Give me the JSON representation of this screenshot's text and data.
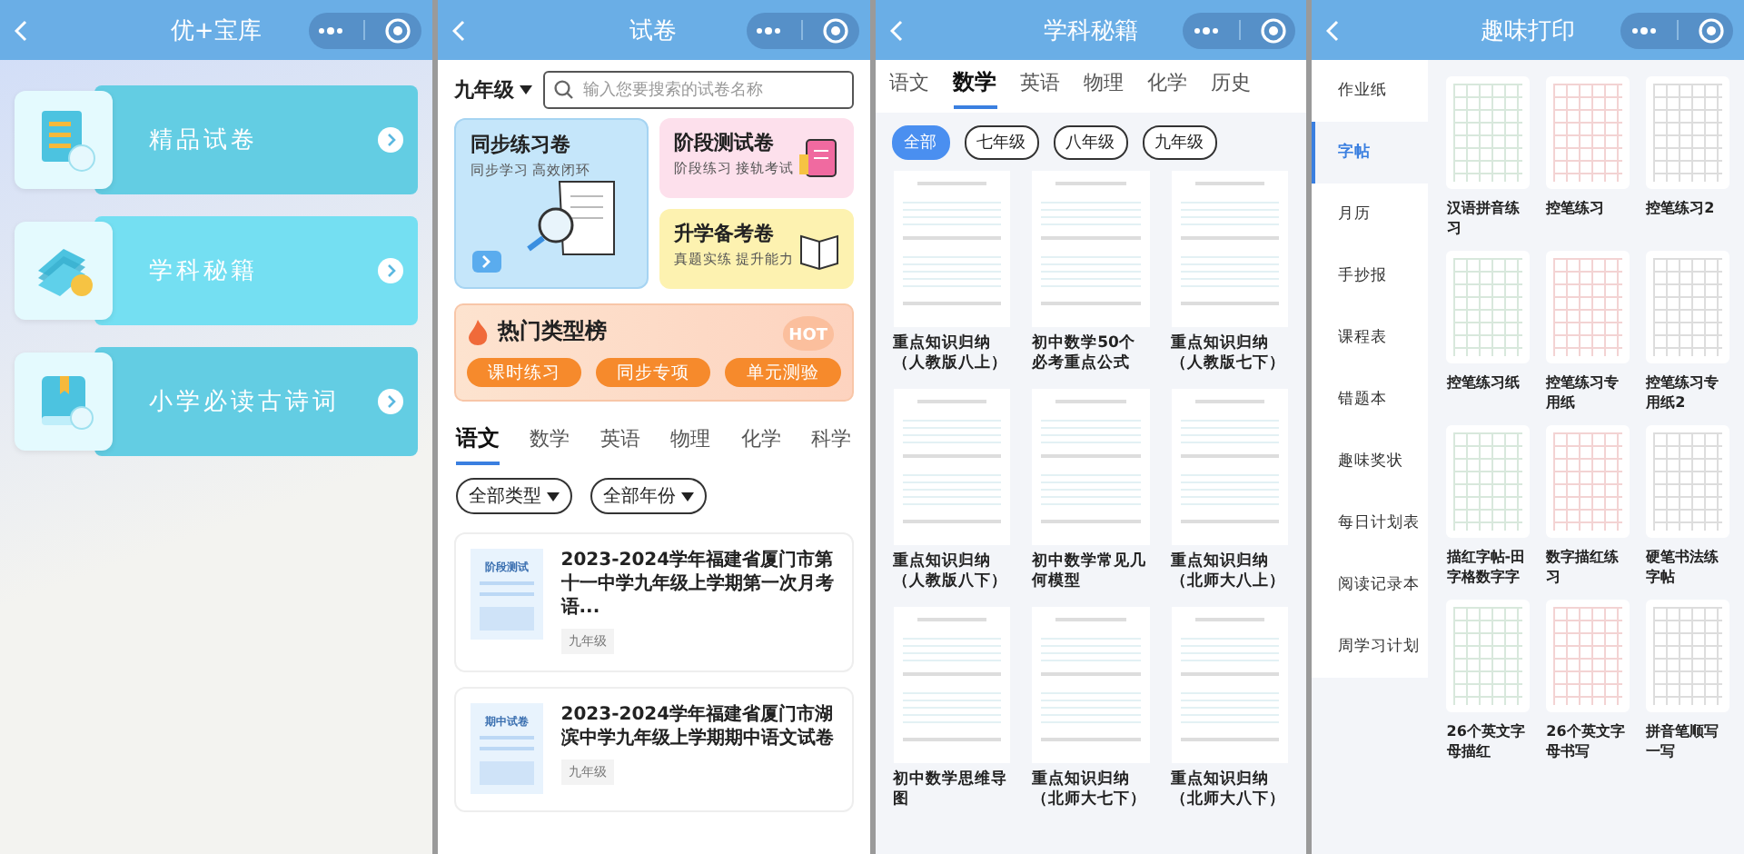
{
  "home": {
    "title": "优+宝库",
    "entries": [
      {
        "kind": "paper",
        "label": "精品试卷"
      },
      {
        "kind": "books",
        "label": "学科秘籍"
      },
      {
        "kind": "book",
        "label": "小学必读古诗词"
      }
    ]
  },
  "exam": {
    "title": "试卷",
    "grade_picker": "九年级",
    "search": {
      "placeholder": "输入您要搜索的试卷名称"
    },
    "cards": [
      {
        "kind": "sync",
        "title": "同步练习卷",
        "subtitle": "同步学习 高效闭环"
      },
      {
        "kind": "stage",
        "title": "阶段测试卷",
        "subtitle": "阶段练习 接轨考试"
      },
      {
        "kind": "entrance",
        "title": "升学备考卷",
        "subtitle": "真题实练 提升能力"
      }
    ],
    "hot": {
      "title": "热门类型榜",
      "mark": "HOT",
      "chips": [
        "课时练习",
        "同步专项",
        "单元测验"
      ]
    },
    "subjects": [
      {
        "label": "语文",
        "selected": true
      },
      {
        "label": "数学",
        "selected": false
      },
      {
        "label": "英语",
        "selected": false
      },
      {
        "label": "物理",
        "selected": false
      },
      {
        "label": "化学",
        "selected": false
      },
      {
        "label": "科学",
        "selected": false
      }
    ],
    "filters": [
      "全部类型",
      "全部年份"
    ],
    "papers": [
      {
        "tag": "阶段测试",
        "title": "2023-2024学年福建省厦门市第十一中学九年级上学期第一次月考语...",
        "grade": "九年级"
      },
      {
        "tag": "期中试卷",
        "title": "2023-2024学年福建省厦门市湖滨中学九年级上学期期中语文试卷",
        "grade": "九年级"
      }
    ]
  },
  "subject": {
    "title": "学科秘籍",
    "tabs": [
      {
        "label": "语文",
        "selected": false
      },
      {
        "label": "数学",
        "selected": true
      },
      {
        "label": "英语",
        "selected": false
      },
      {
        "label": "物理",
        "selected": false
      },
      {
        "label": "化学",
        "selected": false
      },
      {
        "label": "历史",
        "selected": false
      }
    ],
    "grades": [
      {
        "label": "全部",
        "selected": true
      },
      {
        "label": "七年级",
        "selected": false
      },
      {
        "label": "八年级",
        "selected": false
      },
      {
        "label": "九年级",
        "selected": false
      }
    ],
    "items": [
      {
        "title": "重点知识归纳（人教版八上）"
      },
      {
        "title": "初中数学50个必考重点公式"
      },
      {
        "title": "重点知识归纳（人教版七下）"
      },
      {
        "title": "重点知识归纳（人教版八下）"
      },
      {
        "title": "初中数学常见几何模型"
      },
      {
        "title": "重点知识归纳（北师大八上）"
      },
      {
        "title": "初中数学思维导图"
      },
      {
        "title": "重点知识归纳（北师大七下）"
      },
      {
        "title": "重点知识归纳（北师大八下）"
      }
    ]
  },
  "fun": {
    "title": "趣味打印",
    "sidebar": [
      {
        "label": "作业纸",
        "selected": false
      },
      {
        "label": "字帖",
        "selected": true
      },
      {
        "label": "月历",
        "selected": false
      },
      {
        "label": "手抄报",
        "selected": false
      },
      {
        "label": "课程表",
        "selected": false
      },
      {
        "label": "错题本",
        "selected": false
      },
      {
        "label": "趣味奖状",
        "selected": false
      },
      {
        "label": "每日计划表",
        "selected": false
      },
      {
        "label": "阅读记录本",
        "selected": false
      },
      {
        "label": "周学习计划",
        "selected": false
      }
    ],
    "items": [
      {
        "title": "汉语拼音练习"
      },
      {
        "title": "控笔练习"
      },
      {
        "title": "控笔练习2"
      },
      {
        "title": "控笔练习纸"
      },
      {
        "title": "控笔练习专用纸"
      },
      {
        "title": "控笔练习专用纸2"
      },
      {
        "title": "描红字帖-田字格数字字"
      },
      {
        "title": "数字描红练习"
      },
      {
        "title": "硬笔书法练字帖"
      },
      {
        "title": "26个英文字母描红"
      },
      {
        "title": "26个英文字母书写"
      },
      {
        "title": "拼音笔顺写一写"
      }
    ]
  }
}
